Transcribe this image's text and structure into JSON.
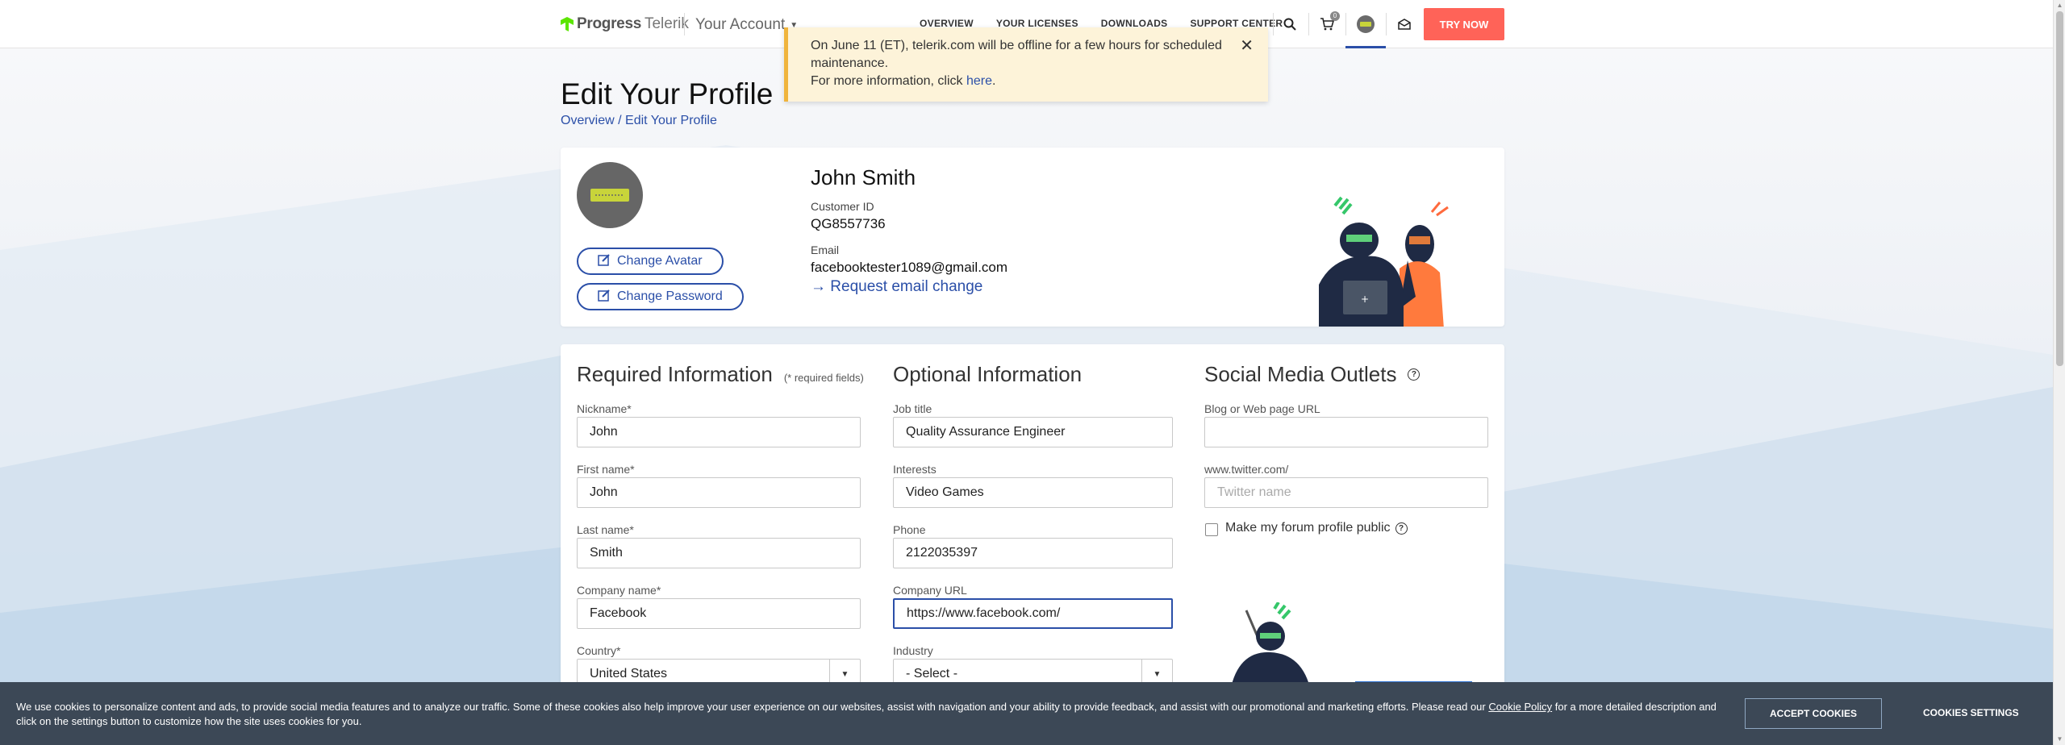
{
  "header": {
    "logo_progress": "Progress",
    "logo_telerik": "Telerik",
    "your_account": "Your Account",
    "nav": [
      "OVERVIEW",
      "YOUR LICENSES",
      "DOWNLOADS",
      "SUPPORT CENTER"
    ],
    "cart_count": "0",
    "try_now": "TRY NOW"
  },
  "notice": {
    "line1": "On June 11 (ET), telerik.com will be offline for a few hours for scheduled maintenance.",
    "line2_prefix": "For more information, click ",
    "link": "here",
    "line2_suffix": "."
  },
  "page": {
    "title": "Edit Your Profile",
    "breadcrumb_overview": "Overview",
    "breadcrumb_sep": " / ",
    "breadcrumb_current": "Edit Your Profile"
  },
  "profile": {
    "change_avatar": "Change Avatar",
    "change_password": "Change Password",
    "name": "John Smith",
    "customer_id_label": "Customer ID",
    "customer_id": "QG8557736",
    "email_label": "Email",
    "email": "facebooktester1089@gmail.com",
    "request_email_change": "Request email change"
  },
  "required": {
    "title": "Required Information",
    "note": "(* required fields)",
    "nickname_label": "Nickname*",
    "nickname": "John",
    "first_name_label": "First name*",
    "first_name": "John",
    "last_name_label": "Last name*",
    "last_name": "Smith",
    "company_label": "Company name*",
    "company": "Facebook",
    "country_label": "Country*",
    "country": "United States"
  },
  "optional": {
    "title": "Optional Information",
    "job_label": "Job title",
    "job": "Quality Assurance Engineer",
    "interests_label": "Interests",
    "interests": "Video Games",
    "phone_label": "Phone",
    "phone": "2122035397",
    "company_url_label": "Company URL",
    "company_url": "https://www.facebook.com/",
    "industry_label": "Industry",
    "industry": "- Select -"
  },
  "social": {
    "title": "Social Media Outlets",
    "blog_label": "Blog or Web page URL",
    "blog": "",
    "twitter_label": "www.twitter.com/",
    "twitter_placeholder": "Twitter name",
    "public_label": "Make my forum profile public"
  },
  "cookie": {
    "text_prefix": "We use cookies to personalize content and ads, to provide social media features and to analyze our traffic. Some of these cookies also help improve your user experience on our websites, assist with navigation and your ability to provide feedback, and assist with our promotional and marketing efforts. Please read our ",
    "policy_link": "Cookie Policy",
    "text_suffix": " for a more detailed description and click on the settings button to customize how the site uses cookies for you.",
    "accept": "ACCEPT COOKIES",
    "settings": "COOKIES SETTINGS"
  },
  "colors": {
    "accent": "#2b4fa8",
    "try_now": "#ff6358",
    "notice_bg": "#fdf3d9",
    "cookie_bg": "#3c4856"
  }
}
